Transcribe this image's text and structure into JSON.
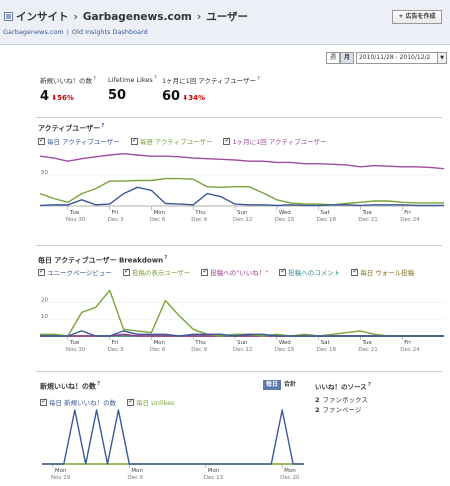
{
  "header": {
    "crumbs": [
      "インサイト",
      "Garbagenews.com",
      "ユーザー"
    ],
    "sub": [
      "Garbagenews.com",
      "Old Insights Dashboard"
    ],
    "ad_button": "+ 広告を作成"
  },
  "date_range": {
    "modes": [
      "週",
      "月"
    ],
    "value": "2010/11/28 - 2010/12/2"
  },
  "kpis": [
    {
      "label": "新規いいね！の数",
      "value": "4",
      "change": "56%",
      "help": "?"
    },
    {
      "label": "Lifetime Likes",
      "value": "50",
      "help": "?"
    },
    {
      "label": "1ヶ月に1回 アクティブユーザー",
      "value": "60",
      "change": "34%",
      "help": "?"
    }
  ],
  "active_section": {
    "title": "アクティブユーザー",
    "legend": [
      "毎日 アクティブユーザー",
      "毎週 アクティブユーザー",
      "1ヶ月に1回 アクティブユーザー"
    ]
  },
  "breakdown_section": {
    "title": "毎日 アクティブユーザー Breakdown",
    "legend": [
      "ユニークページビュー",
      "投稿の表示ユーザー",
      "投稿への\"いいね！\"",
      "投稿へのコメント",
      "毎日 ウォール投稿"
    ]
  },
  "likes_section": {
    "title": "新規いいね！の数",
    "legend": [
      "毎日 新規いいね！の数",
      "毎日 Unlikes"
    ],
    "tabs": [
      "毎日",
      "合計"
    ]
  },
  "sources": {
    "title": "いいね！のソース",
    "items": [
      {
        "count": "2",
        "label": "ファンボックス"
      },
      {
        "count": "2",
        "label": "ファンページ"
      }
    ]
  },
  "colors": {
    "blue": "#3b5998",
    "green": "#7aa23a",
    "purple": "#a04b9e",
    "red": "#cc0000",
    "dark_green": "#356b3f",
    "brown": "#8a6a1f",
    "teal": "#2f8a8a",
    "magenta": "#9a3a8a"
  },
  "chart_data": [
    {
      "type": "line",
      "title": "アクティブユーザー",
      "x_ticks": [
        "Tue",
        "Fri",
        "Mon",
        "Thu",
        "Sun",
        "Wed",
        "Sat",
        "Tue",
        "Fri"
      ],
      "x_sub": [
        "Nov 30",
        "Dec 3",
        "Dec 6",
        "Dec 9",
        "Dec 12",
        "Dec 15",
        "Dec 18",
        "Dec 21",
        "Dec 24"
      ],
      "x_tick_index": [
        2,
        5,
        8,
        11,
        14,
        17,
        20,
        23,
        26
      ],
      "y_ticks": [
        "50"
      ],
      "ylim": [
        0,
        90
      ],
      "series": [
        {
          "name": "毎日 アクティブユーザー",
          "color": "#3b5998",
          "values": [
            1,
            2,
            2,
            10,
            2,
            3,
            20,
            30,
            25,
            4,
            3,
            2,
            20,
            15,
            3,
            2,
            2,
            1,
            2,
            1,
            1,
            2,
            2,
            1,
            2,
            2,
            2,
            1,
            1,
            1
          ]
        },
        {
          "name": "毎週 アクティブユーザー",
          "color": "#7aa23a",
          "values": [
            20,
            12,
            6,
            20,
            28,
            40,
            40,
            41,
            41,
            44,
            44,
            43,
            31,
            30,
            31,
            31,
            21,
            10,
            5,
            3,
            3,
            2,
            4,
            6,
            8,
            8,
            6,
            5,
            5,
            5
          ]
        },
        {
          "name": "1ヶ月に1回 アクティブユーザー",
          "color": "#a04b9e",
          "values": [
            80,
            77,
            72,
            76,
            79,
            82,
            84,
            82,
            80,
            80,
            79,
            77,
            76,
            75,
            74,
            72,
            72,
            70,
            70,
            68,
            68,
            67,
            66,
            63,
            65,
            64,
            63,
            63,
            62,
            60
          ]
        }
      ]
    },
    {
      "type": "line",
      "title": "毎日 アクティブユーザー Breakdown",
      "x_ticks": [
        "Tue",
        "Fri",
        "Mon",
        "Thu",
        "Sun",
        "Wed",
        "Sat",
        "Tue",
        "Fri"
      ],
      "x_sub": [
        "Nov 30",
        "Dec 3",
        "Dec 6",
        "Dec 9",
        "Dec 12",
        "Dec 15",
        "Dec 18",
        "Dec 21",
        "Dec 24"
      ],
      "x_tick_index": [
        2,
        5,
        8,
        11,
        14,
        17,
        20,
        23,
        26
      ],
      "y_ticks": [
        "20",
        "10"
      ],
      "ylim": [
        0,
        32
      ],
      "series": [
        {
          "name": "ユニークページビュー",
          "color": "#3b5998",
          "values": [
            0,
            0,
            0,
            3,
            0,
            0,
            3,
            1,
            1,
            1,
            0,
            1,
            1,
            1,
            0,
            1,
            1,
            0,
            0,
            0,
            0,
            0,
            0,
            0,
            0,
            0,
            0,
            0,
            0,
            0
          ]
        },
        {
          "name": "投稿の表示ユーザー",
          "color": "#7aa23a",
          "values": [
            1,
            1,
            0,
            14,
            17,
            27,
            4,
            3,
            2,
            21,
            12,
            4,
            1,
            0,
            1,
            1,
            0,
            1,
            0,
            1,
            0,
            1,
            2,
            3,
            1,
            0,
            0,
            0,
            0,
            0
          ]
        },
        {
          "name": "投稿への\"いいね！\"",
          "color": "#9a3a8a",
          "values": [
            0,
            0,
            0,
            0,
            0,
            0,
            1,
            0,
            0,
            0,
            0,
            0,
            0,
            0,
            0,
            0,
            0,
            0,
            0,
            0,
            0,
            0,
            0,
            0,
            0,
            0,
            0,
            0,
            0,
            0
          ]
        },
        {
          "name": "投稿へのコメント",
          "color": "#2f8a8a",
          "values": [
            0,
            0,
            0,
            0,
            0,
            0,
            0,
            0,
            0,
            0,
            0,
            0,
            0,
            0,
            0,
            0,
            0,
            0,
            0,
            0,
            0,
            0,
            0,
            0,
            0,
            0,
            0,
            0,
            0,
            0
          ]
        },
        {
          "name": "毎日 ウォール投稿",
          "color": "#8a6a1f",
          "values": [
            0,
            0,
            0,
            0,
            0,
            0,
            0,
            0,
            0,
            0,
            0,
            0,
            0,
            0,
            0,
            0,
            0,
            0,
            0,
            0,
            0,
            0,
            0,
            0,
            0,
            0,
            0,
            0,
            0,
            0
          ]
        }
      ]
    },
    {
      "type": "line",
      "title": "新規いいね！の数",
      "x_ticks": [
        "Mon",
        "Mon",
        "Mon",
        "Mon"
      ],
      "x_sub": [
        "Nov 29",
        "Dec 6",
        "Dec 13",
        "Dec 20"
      ],
      "x_tick_index": [
        1,
        8,
        15,
        22
      ],
      "ylim": [
        0,
        1
      ],
      "series": [
        {
          "name": "毎日 新規いいね！の数",
          "color": "#3b5998",
          "values": [
            0,
            0,
            0,
            1,
            0,
            1,
            0,
            1,
            0,
            0,
            0,
            0,
            0,
            0,
            0,
            0,
            0,
            0,
            0,
            0,
            0,
            0,
            1,
            0,
            0
          ]
        },
        {
          "name": "毎日 Unlikes",
          "color": "#7aa23a",
          "values": [
            0,
            0,
            0,
            0,
            0,
            0,
            0,
            0,
            0,
            0,
            0,
            0,
            0,
            0,
            0,
            0,
            0,
            0,
            0,
            0,
            0,
            0,
            0,
            0,
            0
          ]
        }
      ]
    }
  ]
}
